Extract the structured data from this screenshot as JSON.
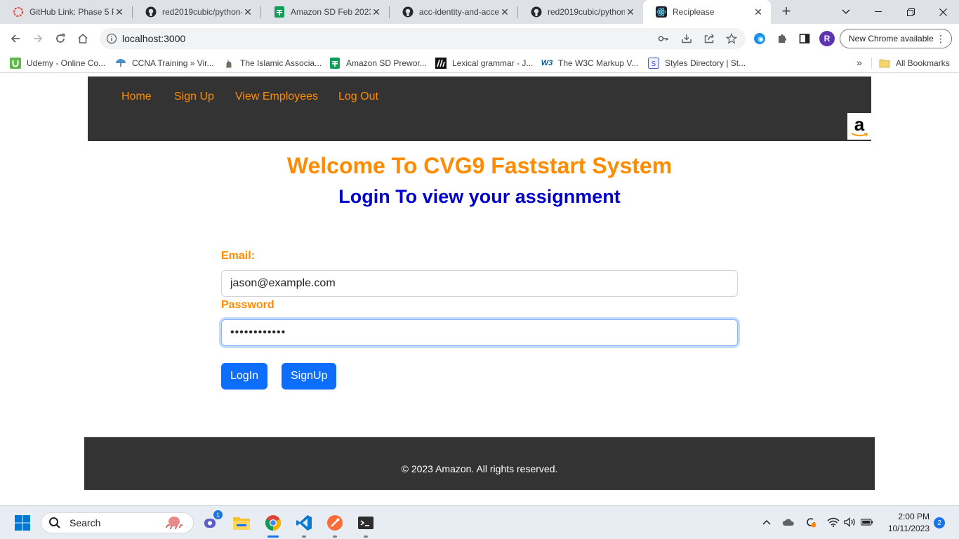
{
  "browser": {
    "tabs": [
      {
        "title": "GitHub Link: Phase 5 P",
        "icon": "asana-icon",
        "active": false
      },
      {
        "title": "red2019cubic/python-",
        "icon": "github-icon",
        "active": false
      },
      {
        "title": "Amazon SD Feb 2023:",
        "icon": "google-sheets-icon",
        "active": false
      },
      {
        "title": "acc-identity-and-acce",
        "icon": "github-icon",
        "active": false
      },
      {
        "title": "red2019cubic/python-",
        "icon": "github-icon",
        "active": false
      },
      {
        "title": "Reciplease",
        "icon": "react-icon",
        "active": true
      }
    ],
    "new_tab_symbol": "+",
    "address": "localhost:3000",
    "profile_initial": "R",
    "update_button": "New Chrome available",
    "bookmarks": [
      {
        "label": "Udemy - Online Co...",
        "icon": "udemy-icon"
      },
      {
        "label": "CCNA Training » Vir...",
        "icon": "umbrella-icon"
      },
      {
        "label": "The Islamic Associa...",
        "icon": "mosque-icon"
      },
      {
        "label": "Amazon SD Prewor...",
        "icon": "google-sheets-icon"
      },
      {
        "label": "Lexical grammar - J...",
        "icon": "mdn-icon"
      },
      {
        "label": "The W3C Markup V...",
        "icon": "w3c-icon"
      },
      {
        "label": "Styles Directory | St...",
        "icon": "styles-icon"
      }
    ],
    "bookmarks_more": "»",
    "all_bookmarks": "All Bookmarks"
  },
  "page": {
    "nav": {
      "home": "Home",
      "signup": "Sign Up",
      "view_employees": "View Employees",
      "logout": "Log Out"
    },
    "logo_letter": "a",
    "heading": "Welcome To CVG9 Faststart System",
    "subheading": "Login To view your assignment",
    "form": {
      "email_label": "Email:",
      "email_value": "jason@example.com",
      "password_label": "Password",
      "password_value": "••••••••••••",
      "login_button": "LogIn",
      "signup_button": "SignUp"
    },
    "footer": "© 2023 Amazon. All rights reserved."
  },
  "taskbar": {
    "search_placeholder": "Search",
    "chat_badge": "1",
    "time": "2:00 PM",
    "date": "10/11/2023",
    "notifications": "2"
  },
  "colors": {
    "accent_orange": "#ff8c00",
    "subheading_blue": "#0000cd",
    "button_blue": "#0d6efd",
    "navbar_bg": "#333333"
  }
}
